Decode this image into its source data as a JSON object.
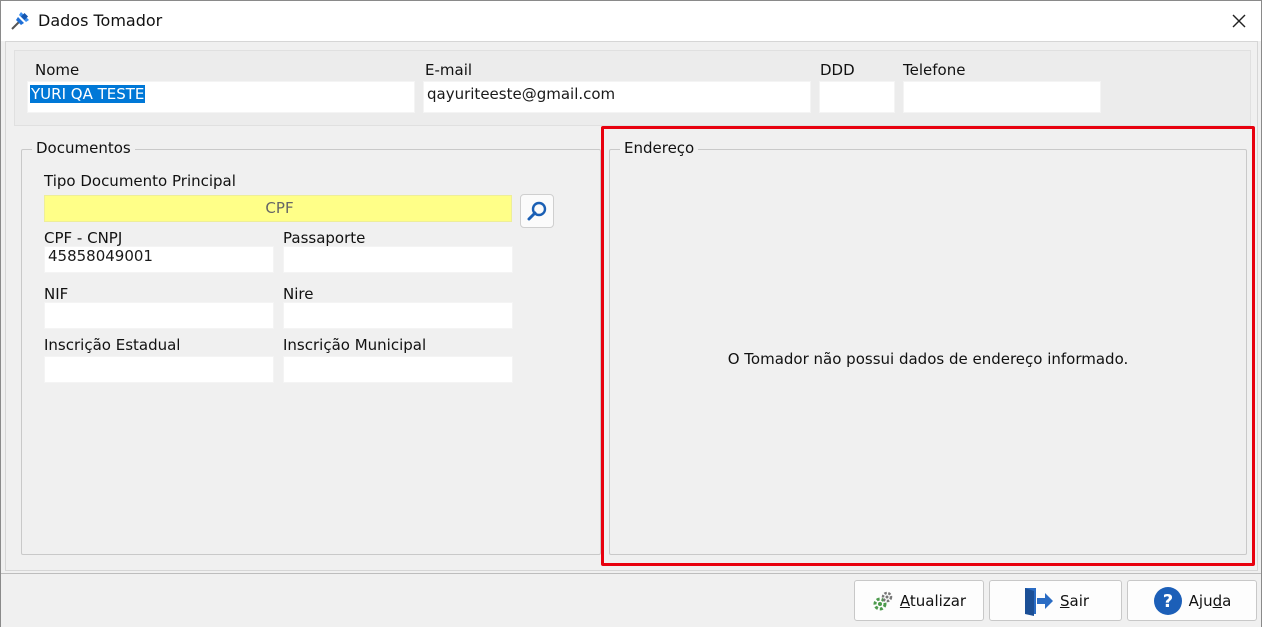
{
  "window": {
    "title": "Dados Tomador"
  },
  "tomador": {
    "nome_label": "Nome",
    "nome_value": "YURI QA TESTE",
    "email_label": "E-mail",
    "email_value": "qayuriteeste@gmail.com",
    "ddd_label": "DDD",
    "ddd_value": "",
    "telefone_label": "Telefone",
    "telefone_value": ""
  },
  "documentos": {
    "title": "Documentos",
    "tipo_label": "Tipo Documento Principal",
    "tipo_value": "CPF",
    "cpf_cnpj_label": "CPF - CNPJ",
    "cpf_cnpj_value": "45858049001",
    "passaporte_label": "Passaporte",
    "passaporte_value": "",
    "nif_label": "NIF",
    "nif_value": "",
    "nire_label": "Nire",
    "nire_value": "",
    "ie_label": "Inscrição Estadual",
    "ie_value": "",
    "im_label": "Inscrição Municipal",
    "im_value": ""
  },
  "endereco": {
    "title": "Endereço",
    "empty_message": "O Tomador não possui dados de endereço informado."
  },
  "buttons": {
    "atualizar": {
      "mnemonic": "A",
      "rest": "tualizar"
    },
    "sair": {
      "mnemonic": "S",
      "rest": "air"
    },
    "ajuda": {
      "pre": "Aju",
      "mnemonic": "d",
      "post": "a"
    }
  },
  "colors": {
    "highlight": "#e8000e",
    "selection": "#0078d7",
    "required_field": "#ffff88"
  }
}
